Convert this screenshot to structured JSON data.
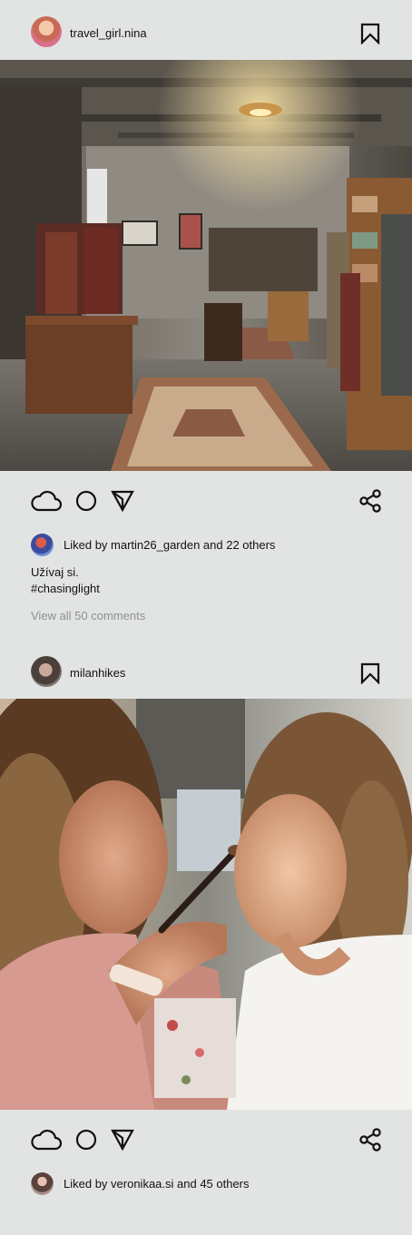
{
  "posts": [
    {
      "username": "travel_girl.nina",
      "photo_alt": "vintage clothing store",
      "likes_text": "Liked by martin26_garden and 22 others",
      "caption_line1": "Užívaj si.",
      "caption_line2": "#chasinglight",
      "view_comments": "View all 50 comments"
    },
    {
      "username": "milanhikes",
      "photo_alt": "makeup artist",
      "likes_text": "Liked by veronikaa.si and 45 others"
    }
  ],
  "icons": {
    "like": "cloud-heart-icon",
    "comment": "circle-comment-icon",
    "send": "send-icon",
    "share": "share-icon",
    "bookmark": "bookmark-icon"
  }
}
